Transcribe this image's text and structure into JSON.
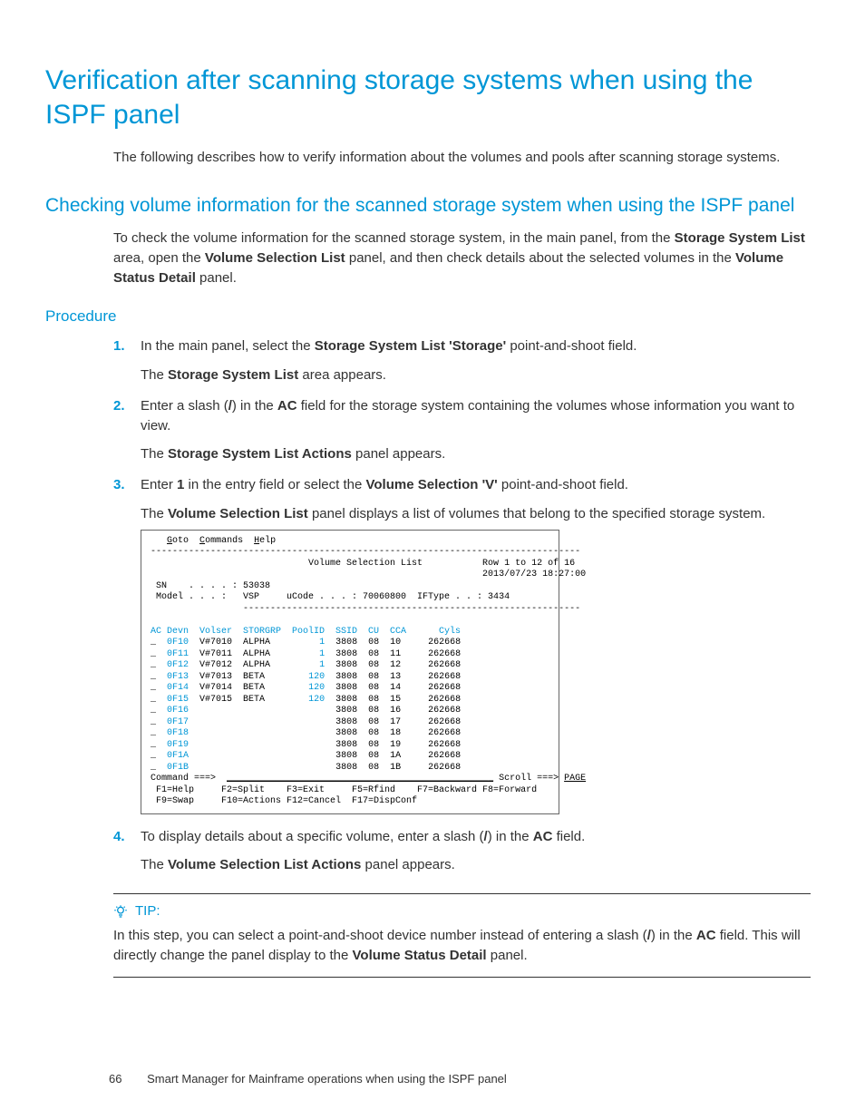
{
  "title": "Verification after scanning storage systems when using the ISPF panel",
  "intro": "The following describes how to verify information about the volumes and pools after scanning storage systems.",
  "section": "Checking volume information for the scanned storage system when using the ISPF panel",
  "section_intro": {
    "pre": "To check the volume information for the scanned storage system, in the main panel, from the ",
    "b1": "Storage System List",
    "mid1": " area, open the ",
    "b2": "Volume Selection List",
    "mid2": " panel, and then check details about the selected volumes in the ",
    "b3": "Volume Status Detail",
    "post": " panel."
  },
  "procedure_heading": "Procedure",
  "steps": [
    {
      "n": "1.",
      "line": {
        "pre": "In the main panel, select the ",
        "b": "Storage System List 'Storage'",
        "post": " point-and-shoot field."
      },
      "after": {
        "pre": "The ",
        "b": "Storage System List",
        "post": " area appears."
      }
    },
    {
      "n": "2.",
      "line": {
        "pre": "Enter a slash (",
        "mid": "/",
        "post": ") in the ",
        "b": "AC",
        "tail": " field for the storage system containing the volumes whose information you want to view."
      },
      "after": {
        "pre": "The ",
        "b": "Storage System List Actions",
        "post": " panel appears."
      }
    },
    {
      "n": "3.",
      "line": {
        "pre": "Enter ",
        "b1": "1",
        "mid": " in the entry field or select the ",
        "b2": "Volume Selection 'V'",
        "post": " point-and-shoot field."
      },
      "after": {
        "pre": "The ",
        "b": "Volume Selection List",
        "post": " panel displays a list of volumes that belong to the specified storage system."
      }
    },
    {
      "n": "4.",
      "line": {
        "pre": "To display details about a specific volume, enter a slash (",
        "mid": "/",
        "post": ") in the ",
        "b": "AC",
        "tail": " field."
      },
      "after": {
        "pre": "The ",
        "b": "Volume Selection List Actions",
        "post": " panel appears."
      }
    }
  ],
  "terminal": {
    "menu": {
      "goto": "Goto",
      "commands": "Commands",
      "help": "Help"
    },
    "rule": "-------------------------------------------------------------------------------",
    "title": "Volume Selection List",
    "row_info": "Row 1 to 12 of 16",
    "timestamp": "2013/07/23 18:27:00",
    "sn_label": "SN",
    "sn_dots": ". . . . :",
    "sn_value": "53038",
    "model_label": "Model",
    "model_dots": ". . . :",
    "model_value": "VSP",
    "ucode_label": "uCode",
    "ucode_dots": ". . . :",
    "ucode_value": "70060800",
    "iftype_label": "IFType",
    "iftype_dots": ". . :",
    "iftype_value": "3434",
    "cols": {
      "ac": "AC",
      "devn": "Devn",
      "volser": "Volser",
      "storgrp": "STORGRP",
      "poolid": "PoolID",
      "ssid": "SSID",
      "cu": "CU",
      "cca": "CCA",
      "cyls": "Cyls"
    },
    "rows": [
      {
        "ac": "_",
        "devn": "0F10",
        "volser": "V#7010",
        "storgrp": "ALPHA",
        "poolid": "1",
        "ssid": "3808",
        "cu": "08",
        "cca": "10",
        "cyls": "262668"
      },
      {
        "ac": "_",
        "devn": "0F11",
        "volser": "V#7011",
        "storgrp": "ALPHA",
        "poolid": "1",
        "ssid": "3808",
        "cu": "08",
        "cca": "11",
        "cyls": "262668"
      },
      {
        "ac": "_",
        "devn": "0F12",
        "volser": "V#7012",
        "storgrp": "ALPHA",
        "poolid": "1",
        "ssid": "3808",
        "cu": "08",
        "cca": "12",
        "cyls": "262668"
      },
      {
        "ac": "_",
        "devn": "0F13",
        "volser": "V#7013",
        "storgrp": "BETA",
        "poolid": "120",
        "ssid": "3808",
        "cu": "08",
        "cca": "13",
        "cyls": "262668"
      },
      {
        "ac": "_",
        "devn": "0F14",
        "volser": "V#7014",
        "storgrp": "BETA",
        "poolid": "120",
        "ssid": "3808",
        "cu": "08",
        "cca": "14",
        "cyls": "262668"
      },
      {
        "ac": "_",
        "devn": "0F15",
        "volser": "V#7015",
        "storgrp": "BETA",
        "poolid": "120",
        "ssid": "3808",
        "cu": "08",
        "cca": "15",
        "cyls": "262668"
      },
      {
        "ac": "_",
        "devn": "0F16",
        "volser": "",
        "storgrp": "",
        "poolid": "",
        "ssid": "3808",
        "cu": "08",
        "cca": "16",
        "cyls": "262668"
      },
      {
        "ac": "_",
        "devn": "0F17",
        "volser": "",
        "storgrp": "",
        "poolid": "",
        "ssid": "3808",
        "cu": "08",
        "cca": "17",
        "cyls": "262668"
      },
      {
        "ac": "_",
        "devn": "0F18",
        "volser": "",
        "storgrp": "",
        "poolid": "",
        "ssid": "3808",
        "cu": "08",
        "cca": "18",
        "cyls": "262668"
      },
      {
        "ac": "_",
        "devn": "0F19",
        "volser": "",
        "storgrp": "",
        "poolid": "",
        "ssid": "3808",
        "cu": "08",
        "cca": "19",
        "cyls": "262668"
      },
      {
        "ac": "_",
        "devn": "0F1A",
        "volser": "",
        "storgrp": "",
        "poolid": "",
        "ssid": "3808",
        "cu": "08",
        "cca": "1A",
        "cyls": "262668"
      },
      {
        "ac": "_",
        "devn": "0F1B",
        "volser": "",
        "storgrp": "",
        "poolid": "",
        "ssid": "3808",
        "cu": "08",
        "cca": "1B",
        "cyls": "262668"
      }
    ],
    "cmd_label": "Command ===>",
    "cmd_line": "_________________________________________________",
    "scroll_label": "Scroll ===>",
    "scroll_value": "PAGE",
    "fkeys1": {
      "f1": "F1=Help",
      "f2": "F2=Split",
      "f3": "F3=Exit",
      "f5": "F5=Rfind",
      "f7": "F7=Backward",
      "f8": "F8=Forward"
    },
    "fkeys2": {
      "f9": "F9=Swap",
      "f10": "F10=Actions",
      "f12": "F12=Cancel",
      "f17": "F17=DispConf"
    }
  },
  "tip": {
    "label": "TIP:",
    "pre": "In this step, you can select a point-and-shoot device number instead of entering a slash (",
    "mid": "/",
    "post": ") in the ",
    "b1": "AC",
    "mid2": " field. This will directly change the panel display to the ",
    "b2": "Volume Status Detail",
    "tail": " panel."
  },
  "footer": {
    "page": "66",
    "text": "Smart Manager for Mainframe operations when using the ISPF panel"
  }
}
